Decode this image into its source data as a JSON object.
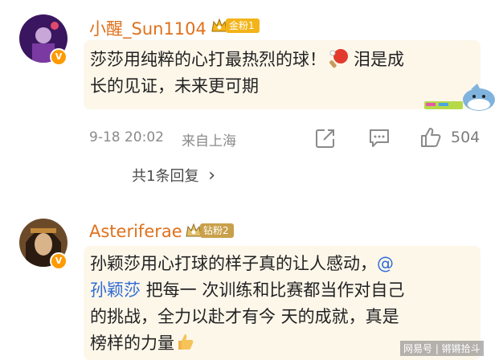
{
  "comments": [
    {
      "username": "小醒_Sun1104",
      "fan_badge": "金粉1",
      "text_lines": [
        "莎莎用纯粹的心打最热烈的球！",
        "长的见证，未来更可期"
      ],
      "text_after_emoji": "泪是成",
      "time": "9-18 20:02",
      "location": "来自上海",
      "like_count": "504",
      "replies_label": "共1条回复",
      "replies_chevron": "›"
    },
    {
      "username": "Asteriferae",
      "fan_badge": "钻粉2",
      "text_lines": [
        "孙颖莎用心打球的样子真的让人感动，@",
        "孙颖莎 把每一 次训练和比赛都当作对自己",
        "的挑战，全力以赴才有今 天的成就，真是",
        "榜样的力量"
      ]
    }
  ],
  "watermark": "网易号 | 锵锵拾斗",
  "colors": {
    "username": "#e0711b",
    "gold_badge": "#f3b41a",
    "diamond_badge": "#c9a04a",
    "mention": "#2f6bd6"
  }
}
